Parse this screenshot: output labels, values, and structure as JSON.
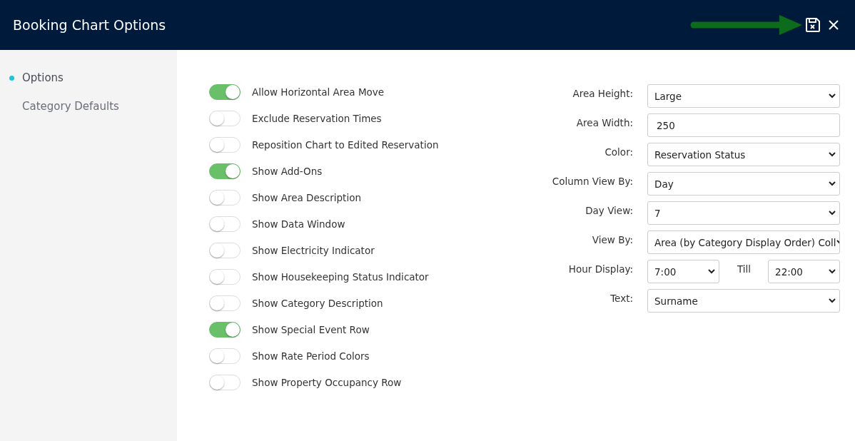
{
  "window": {
    "title": "Booking Chart Options"
  },
  "sidebar": {
    "items": [
      {
        "label": "Options",
        "selected": true
      },
      {
        "label": "Category Defaults",
        "selected": false
      }
    ]
  },
  "toggles": [
    {
      "label": "Allow Horizontal Area Move",
      "on": true
    },
    {
      "label": "Exclude Reservation Times",
      "on": false
    },
    {
      "label": "Reposition Chart to Edited Reservation",
      "on": false
    },
    {
      "label": "Show Add-Ons",
      "on": true
    },
    {
      "label": "Show Area Description",
      "on": false
    },
    {
      "label": "Show Data Window",
      "on": false
    },
    {
      "label": "Show Electricity Indicator",
      "on": false
    },
    {
      "label": "Show Housekeeping Status Indicator",
      "on": false
    },
    {
      "label": "Show Category Description",
      "on": false
    },
    {
      "label": "Show Special Event Row",
      "on": true
    },
    {
      "label": "Show Rate Period Colors",
      "on": false
    },
    {
      "label": "Show Property Occupancy Row",
      "on": false
    }
  ],
  "fields": [
    {
      "kind": "select",
      "label": "Area Height:",
      "value": "Large"
    },
    {
      "kind": "text",
      "label": "Area Width:",
      "value": "250"
    },
    {
      "kind": "select",
      "label": "Color:",
      "value": "Reservation Status"
    },
    {
      "kind": "select",
      "label": "Column View By:",
      "value": "Day"
    },
    {
      "kind": "select",
      "label": "Day View:",
      "value": "7"
    },
    {
      "kind": "select",
      "label": "View By:",
      "value": "Area (by Category Display Order) Coll"
    },
    {
      "kind": "range",
      "label": "Hour Display:",
      "value": "7:00",
      "separator": "Till",
      "end_value": "22:00"
    },
    {
      "kind": "select",
      "label": "Text:",
      "value": "Surname"
    }
  ]
}
